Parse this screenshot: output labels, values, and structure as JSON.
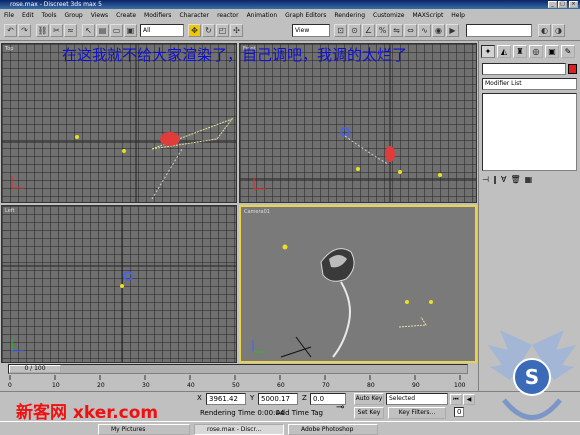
{
  "window": {
    "title": "rose.max - Discreet 3ds max 5"
  },
  "menu": [
    "File",
    "Edit",
    "Tools",
    "Group",
    "Views",
    "Create",
    "Modifiers",
    "Character",
    "reactor",
    "Animation",
    "Graph Editors",
    "Rendering",
    "Customize",
    "MAXScript",
    "Help"
  ],
  "toolbar": {
    "filter_value": "All",
    "view_value": "View",
    "named_selection": ""
  },
  "overlay_text": "在这我就不给大家渲染了，自己调吧，我调的太烂了",
  "viewports": {
    "top": {
      "label": "Top"
    },
    "front": {
      "label": "Front"
    },
    "left": {
      "label": "Left"
    },
    "camera": {
      "label": "Camera01"
    }
  },
  "command_panel": {
    "object_name": "",
    "modifier_list": "Modifier List"
  },
  "timeline": {
    "slider_label": "0 / 100",
    "ticks": [
      "0",
      "10",
      "20",
      "30",
      "40",
      "50",
      "60",
      "70",
      "80",
      "90",
      "100"
    ]
  },
  "status": {
    "x_label": "X",
    "x_value": "3961.42",
    "y_label": "Y",
    "y_value": "5000.17",
    "z_label": "Z",
    "z_value": "0.0",
    "rendering_time": "Rendering Time  0:00:04",
    "add_time_tag": "Add Time Tag",
    "auto_key": "Auto Key",
    "selected": "Selected",
    "set_key": "Set Key",
    "key_filters": "Key Filters..."
  },
  "taskbar": {
    "tasks": [
      "My Pictures",
      "rose.max - Discr...",
      "Adobe Photoshop"
    ]
  },
  "watermark": {
    "text": "新客网 xker.com"
  },
  "colors": {
    "active_viewport": "#e8d34a",
    "overlay": "#1010d0",
    "watermark": "#e11111"
  }
}
